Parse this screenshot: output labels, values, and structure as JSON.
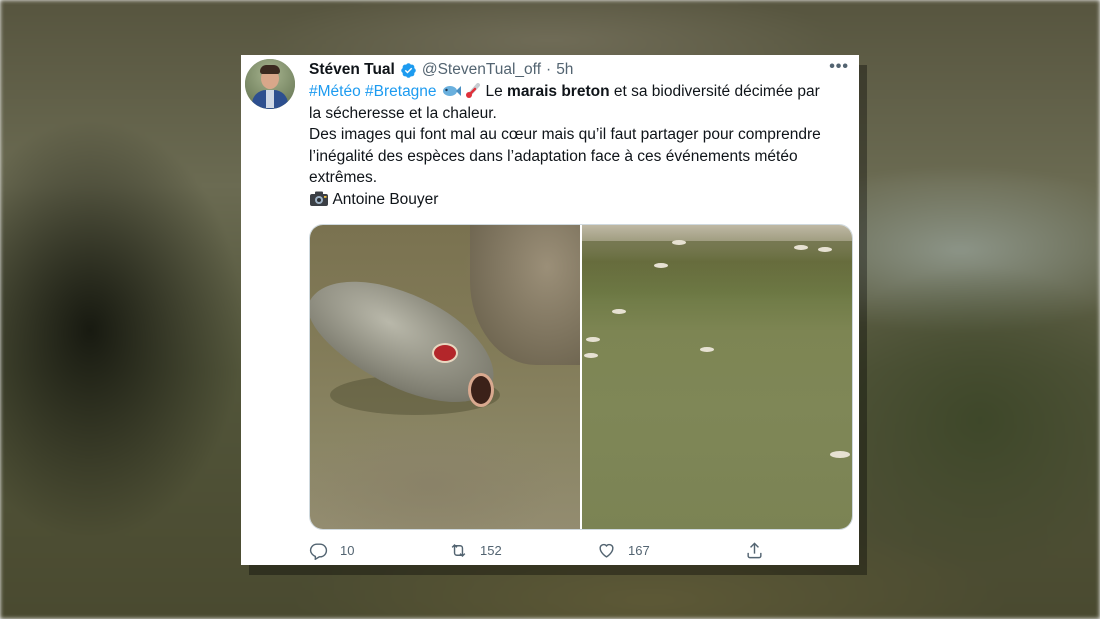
{
  "tweet": {
    "author_name": "Stéven Tual",
    "handle": "@StevenTual_off",
    "separator": "·",
    "time": "5h",
    "more_label": "•••",
    "hashtags": [
      "#Météo",
      "#Bretagne"
    ],
    "line1_prefix": " Le ",
    "line1_bold": "marais breton",
    "line1_suffix": " et sa biodiversité décimée par",
    "line2": "la sécheresse et la chaleur.",
    "line3": "Des images qui font mal au cœur mais qu’il faut partager pour comprendre",
    "line4": "l’inégalité des espèces dans l’adaptation face à ces événements météo",
    "line5": "extrêmes.",
    "credit": "Antoine Bouyer",
    "icons": {
      "fish": "fish-icon",
      "thermometer": "thermometer-icon",
      "camera": "camera-icon",
      "verified": "verified-badge-icon"
    }
  },
  "actions": {
    "replies": "10",
    "retweets": "152",
    "likes": "167"
  },
  "colors": {
    "link": "#1d9bf0",
    "secondary_text": "#536471",
    "primary_text": "#0f1419"
  }
}
